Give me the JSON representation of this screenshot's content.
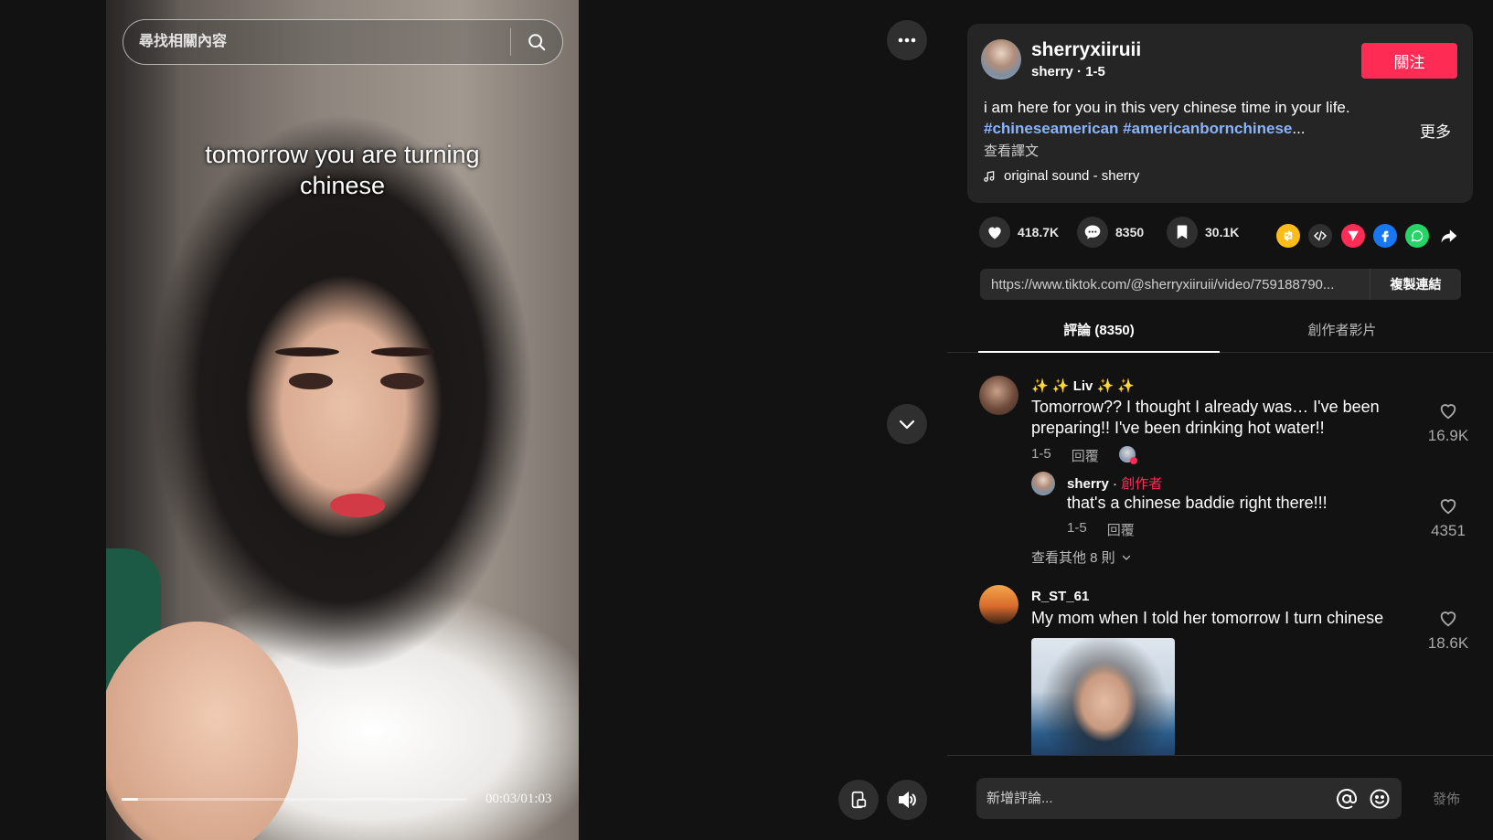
{
  "search": {
    "placeholder": "尋找相關內容"
  },
  "video": {
    "caption_line1": "tomorrow you are turning",
    "caption_line2": "chinese",
    "time": "00:03/01:03",
    "progress": 0.048
  },
  "author": {
    "username": "sherryxiiruii",
    "nickname_date": "sherry · 1-5",
    "follow_label": "關注"
  },
  "description": {
    "text": "i am here for you in this very chinese time in your life.",
    "hashtag1": "#chineseamerican",
    "hashtag2": "#americanbornchinese",
    "ellipsis": "...",
    "more_label": "更多",
    "translate_label": "查看譯文",
    "music": "original sound - sherry"
  },
  "actions": {
    "likes": "418.7K",
    "comments": "8350",
    "saves": "30.1K"
  },
  "share": {
    "link": "https://www.tiktok.com/@sherryxiiruii/video/759188790...",
    "copy_label": "複製連結"
  },
  "tabs": {
    "comments_label": "評論 (8350)",
    "creator_videos_label": "創作者影片"
  },
  "comments": [
    {
      "user": "✨ ✨ Liv ✨ ✨",
      "text_line1": "Tomorrow?? I thought I already was… I've been",
      "text_line2": "preparing!! I've been drinking hot water!!",
      "date": "1-5",
      "reply_label": "回覆",
      "likes": "16.9K",
      "replies": [
        {
          "user": "sherry",
          "separator": " · ",
          "tag": "創作者",
          "text": "that's a chinese baddie right there!!!",
          "date": "1-5",
          "reply_label": "回覆",
          "likes": "4351"
        }
      ],
      "view_more_label": "查看其他 8 則"
    },
    {
      "user": "R_ST_61",
      "text": "My mom when I told her tomorrow I turn chinese",
      "likes": "18.6K"
    }
  ],
  "comment_bar": {
    "placeholder": "新增評論...",
    "post_label": "發佈"
  },
  "colors": {
    "accent": "#fe2c55",
    "hashtag": "#8ab4f8",
    "background": "#121212",
    "card": "#252525"
  }
}
